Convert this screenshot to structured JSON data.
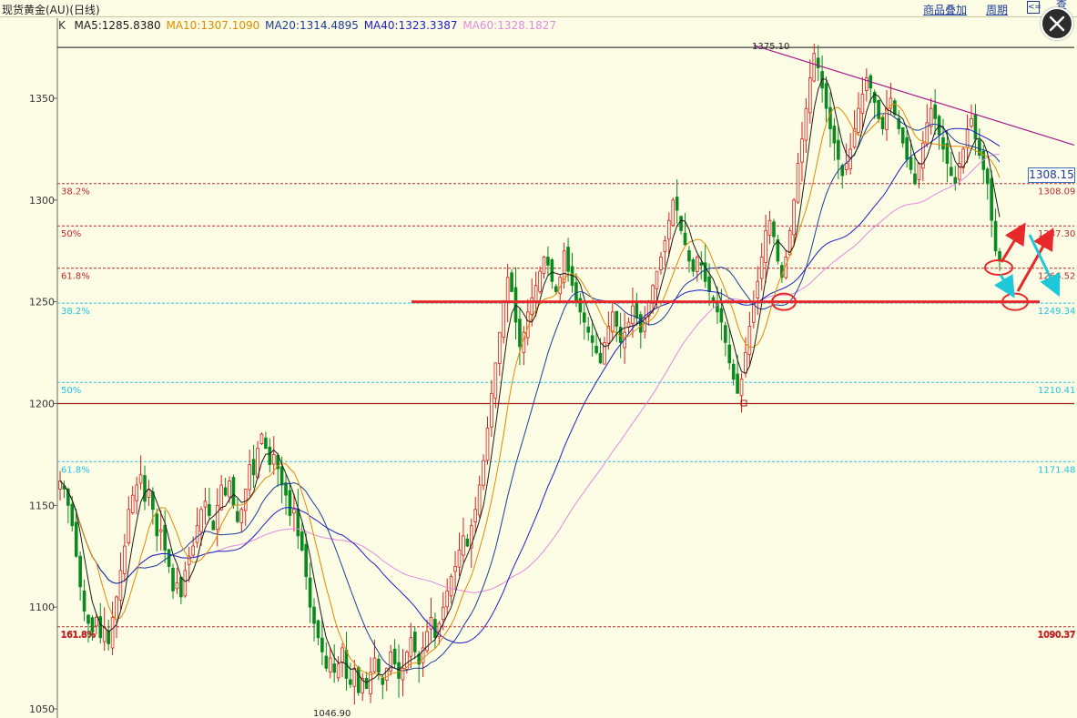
{
  "header": {
    "title": "现货黄金(AU)(日线)",
    "overlay_label": "商品叠加",
    "period_label": "周期",
    "back_label": "<=",
    "view_label": "查看"
  },
  "legend": {
    "k_label": "K",
    "items": [
      {
        "label": "MA5:1285.8380",
        "color": "#1a1a1a"
      },
      {
        "label": "MA10:1307.1090",
        "color": "#e08a00"
      },
      {
        "label": "MA20:1314.4895",
        "color": "#1a3b9a"
      },
      {
        "label": "MA40:1323.3387",
        "color": "#1c1cc8"
      },
      {
        "label": "MA60:1328.1827",
        "color": "#e08ae0"
      }
    ]
  },
  "current_price": "1308.15",
  "colors": {
    "up": "#d81e1e",
    "down": "#0a8a1e",
    "ma5": "#1a1a1a",
    "ma10": "#e08a00",
    "ma20": "#1a3b9a",
    "ma40": "#1c1cc8",
    "ma60": "#e08ae0",
    "fib_red": "#c0282a",
    "fib_cyan": "#23c4e0",
    "trend": "#a01a8a"
  },
  "chart_data": {
    "type": "candlestick",
    "title": "现货黄金(AU)(日线)",
    "ylim": [
      1045,
      1380
    ],
    "yticks": [
      1050,
      1100,
      1150,
      1200,
      1250,
      1300,
      1350
    ],
    "high_label": "1375.10",
    "low_label": "1046.90",
    "fib_levels_upper": [
      {
        "pct": "38.2%",
        "value": 1308.09,
        "value_label": "1308.09"
      },
      {
        "pct": "50%",
        "value": 1287.3,
        "value_label": "1287.30"
      },
      {
        "pct": "61.8%",
        "value": 1266.52,
        "value_label": "1266.52"
      }
    ],
    "fib_levels_lower": [
      {
        "pct": "38.2%",
        "value": 1249.34,
        "value_label": "1249.34"
      },
      {
        "pct": "50%",
        "value": 1210.41,
        "value_label": "1210.41"
      },
      {
        "pct": "61.8%",
        "value": 1171.48,
        "value_label": "1171.48"
      },
      {
        "pct": "161.8%",
        "value": 1090.37,
        "value_label": "1090.37"
      }
    ],
    "support_line": 1250,
    "level_1200": 1200,
    "top_line": 1375,
    "trendline": [
      {
        "day": 305,
        "price": 1376
      },
      {
        "day": 420,
        "price": 1327
      }
    ],
    "closes": [
      1162,
      1158,
      1150,
      1140,
      1125,
      1110,
      1098,
      1092,
      1088,
      1095,
      1085,
      1090,
      1082,
      1095,
      1105,
      1118,
      1130,
      1148,
      1155,
      1160,
      1165,
      1152,
      1158,
      1148,
      1135,
      1138,
      1128,
      1120,
      1108,
      1112,
      1105,
      1118,
      1125,
      1130,
      1140,
      1148,
      1152,
      1145,
      1138,
      1150,
      1160,
      1155,
      1162,
      1150,
      1142,
      1148,
      1158,
      1170,
      1165,
      1178,
      1185,
      1178,
      1170,
      1175,
      1168,
      1160,
      1155,
      1145,
      1148,
      1135,
      1128,
      1115,
      1100,
      1092,
      1085,
      1078,
      1070,
      1075,
      1068,
      1072,
      1080,
      1065,
      1062,
      1070,
      1058,
      1065,
      1060,
      1068,
      1075,
      1068,
      1062,
      1070,
      1078,
      1072,
      1065,
      1070,
      1078,
      1085,
      1078,
      1072,
      1080,
      1088,
      1095,
      1085,
      1092,
      1100,
      1108,
      1115,
      1120,
      1128,
      1135,
      1130,
      1140,
      1148,
      1160,
      1172,
      1188,
      1205,
      1220,
      1235,
      1250,
      1262,
      1255,
      1240,
      1228,
      1235,
      1245,
      1252,
      1258,
      1265,
      1272,
      1268,
      1260,
      1255,
      1262,
      1275,
      1265,
      1258,
      1250,
      1245,
      1240,
      1235,
      1230,
      1225,
      1220,
      1230,
      1238,
      1245,
      1238,
      1230,
      1235,
      1240,
      1248,
      1242,
      1235,
      1242,
      1250,
      1258,
      1265,
      1272,
      1280,
      1290,
      1300,
      1295,
      1285,
      1278,
      1270,
      1265,
      1272,
      1268,
      1260,
      1255,
      1250,
      1245,
      1240,
      1230,
      1220,
      1212,
      1205,
      1212,
      1225,
      1238,
      1250,
      1260,
      1272,
      1285,
      1290,
      1282,
      1270,
      1262,
      1272,
      1285,
      1300,
      1318,
      1330,
      1345,
      1360,
      1372,
      1365,
      1355,
      1345,
      1335,
      1328,
      1320,
      1312,
      1318,
      1325,
      1335,
      1345,
      1352,
      1360,
      1355,
      1348,
      1340,
      1335,
      1345,
      1350,
      1342,
      1335,
      1328,
      1320,
      1315,
      1308,
      1318,
      1328,
      1338,
      1345,
      1340,
      1332,
      1325,
      1318,
      1312,
      1308,
      1318,
      1325,
      1335,
      1340,
      1330,
      1322,
      1315,
      1308,
      1290,
      1275,
      1270
    ]
  }
}
